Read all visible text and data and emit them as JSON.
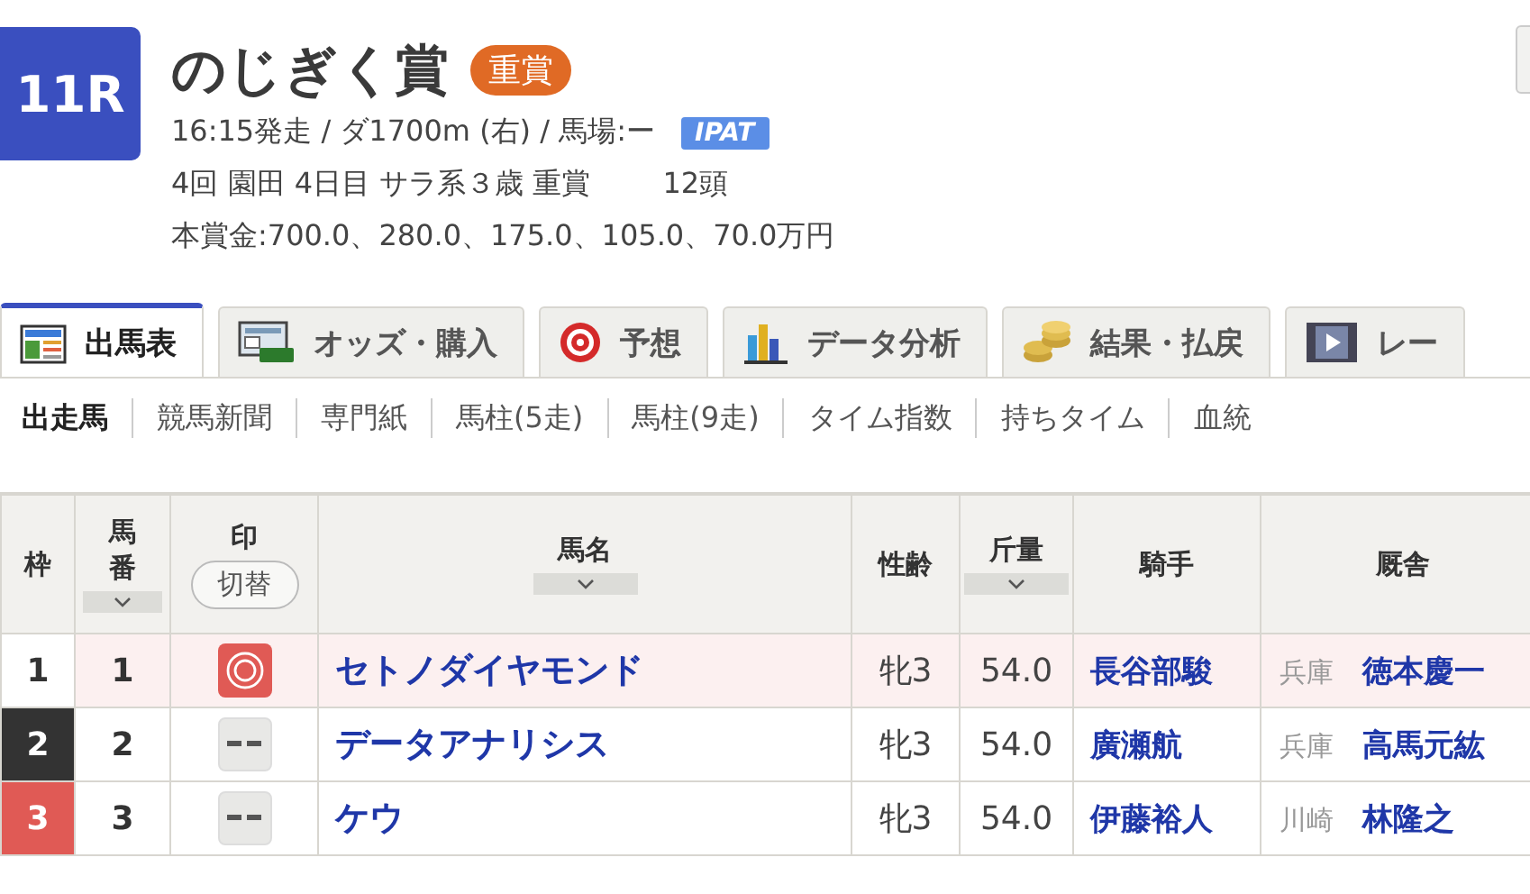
{
  "race": {
    "number": "11R",
    "title": "のじぎく賞",
    "grade_badge": "重賞",
    "info_line": "16:15発走 / ダ1700m (右) / 馬場:ー",
    "ipat_badge": "IPAT",
    "meta_line": "4回 園田 4日目 サラ系３歳 重賞",
    "head_count": "12頭",
    "prize_line": "本賞金:700.0、280.0、175.0、105.0、70.0万円"
  },
  "tabs": [
    {
      "label": "出馬表",
      "selected": true
    },
    {
      "label": "オッズ・購入",
      "selected": false
    },
    {
      "label": "予想",
      "selected": false
    },
    {
      "label": "データ分析",
      "selected": false
    },
    {
      "label": "結果・払戻",
      "selected": false
    },
    {
      "label": "レー",
      "selected": false
    }
  ],
  "sub_tabs": [
    {
      "label": "出走馬",
      "selected": true
    },
    {
      "label": "競馬新聞",
      "selected": false
    },
    {
      "label": "専門紙",
      "selected": false
    },
    {
      "label": "馬柱(5走)",
      "selected": false
    },
    {
      "label": "馬柱(9走)",
      "selected": false
    },
    {
      "label": "タイム指数",
      "selected": false
    },
    {
      "label": "持ちタイム",
      "selected": false
    },
    {
      "label": "血統",
      "selected": false
    }
  ],
  "table": {
    "columns": [
      {
        "label": "枠",
        "sortable": false
      },
      {
        "label": "馬番",
        "sortable": true
      },
      {
        "label": "印",
        "sortable": false
      },
      {
        "label": "馬名",
        "sortable": true
      },
      {
        "label": "性齢",
        "sortable": false
      },
      {
        "label": "斤量",
        "sortable": true
      },
      {
        "label": "騎手",
        "sortable": false
      },
      {
        "label": "厩舎",
        "sortable": false
      }
    ],
    "mark_toggle": "切替",
    "rows": [
      {
        "frame": "1",
        "color": "#ffffff",
        "number": "1",
        "marked": true,
        "highlighted": true,
        "horse": "セトノダイヤモンド",
        "sex_age": "牝3",
        "weight": "54.0",
        "jockey": "長谷部駿",
        "stable_region": "兵庫",
        "trainer": "徳本慶一"
      },
      {
        "frame": "2",
        "color": "#333333",
        "number": "2",
        "marked": false,
        "highlighted": false,
        "horse": "データアナリシス",
        "sex_age": "牝3",
        "weight": "54.0",
        "jockey": "廣瀬航",
        "stable_region": "兵庫",
        "trainer": "高馬元紘"
      },
      {
        "frame": "3",
        "color": "#e05a55",
        "number": "3",
        "marked": false,
        "highlighted": false,
        "horse": "ケウ",
        "sex_age": "牝3",
        "weight": "54.0",
        "jockey": "伊藤裕人",
        "stable_region": "川崎",
        "trainer": "林隆之"
      }
    ]
  }
}
